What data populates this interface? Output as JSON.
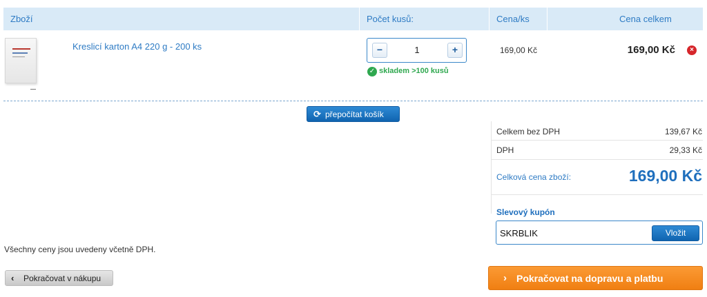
{
  "table_header": {
    "product": "Zboží",
    "quantity": "Počet kusů:",
    "unit_price": "Cena/ks",
    "total_price": "Cena celkem"
  },
  "items": [
    {
      "name": "Kreslicí karton A4 220 g - 200 ks",
      "quantity": "1",
      "stock": "skladem >100 kusů",
      "unit_price": "169,00 Kč",
      "total": "169,00 Kč"
    }
  ],
  "icons": {
    "minus": "−",
    "plus": "+",
    "stock_ok": "✓",
    "remove": "×",
    "recalc": "⟳",
    "back": "‹",
    "continue": "›"
  },
  "actions": {
    "recalculate": "přepočítat košík",
    "back": "Pokračovat v nákupu",
    "continue": "Pokračovat na dopravu a platbu"
  },
  "summary": {
    "without_vat_label": "Celkem bez DPH",
    "without_vat_value": "139,67 Kč",
    "vat_label": "DPH",
    "vat_value": "29,33 Kč",
    "total_label": "Celková cena zboží:",
    "total_value": "169,00 Kč"
  },
  "coupon": {
    "title": "Slevový kupón",
    "value": "SKRBLIK",
    "submit": "Vložit"
  },
  "note": "Všechny ceny jsou uvedeny včetně DPH.",
  "colors": {
    "accent": "#2e7bc4",
    "header_bg": "#d9eaf7",
    "success": "#2fa84f",
    "danger": "#d6262b",
    "cta": "#f38a1e"
  }
}
